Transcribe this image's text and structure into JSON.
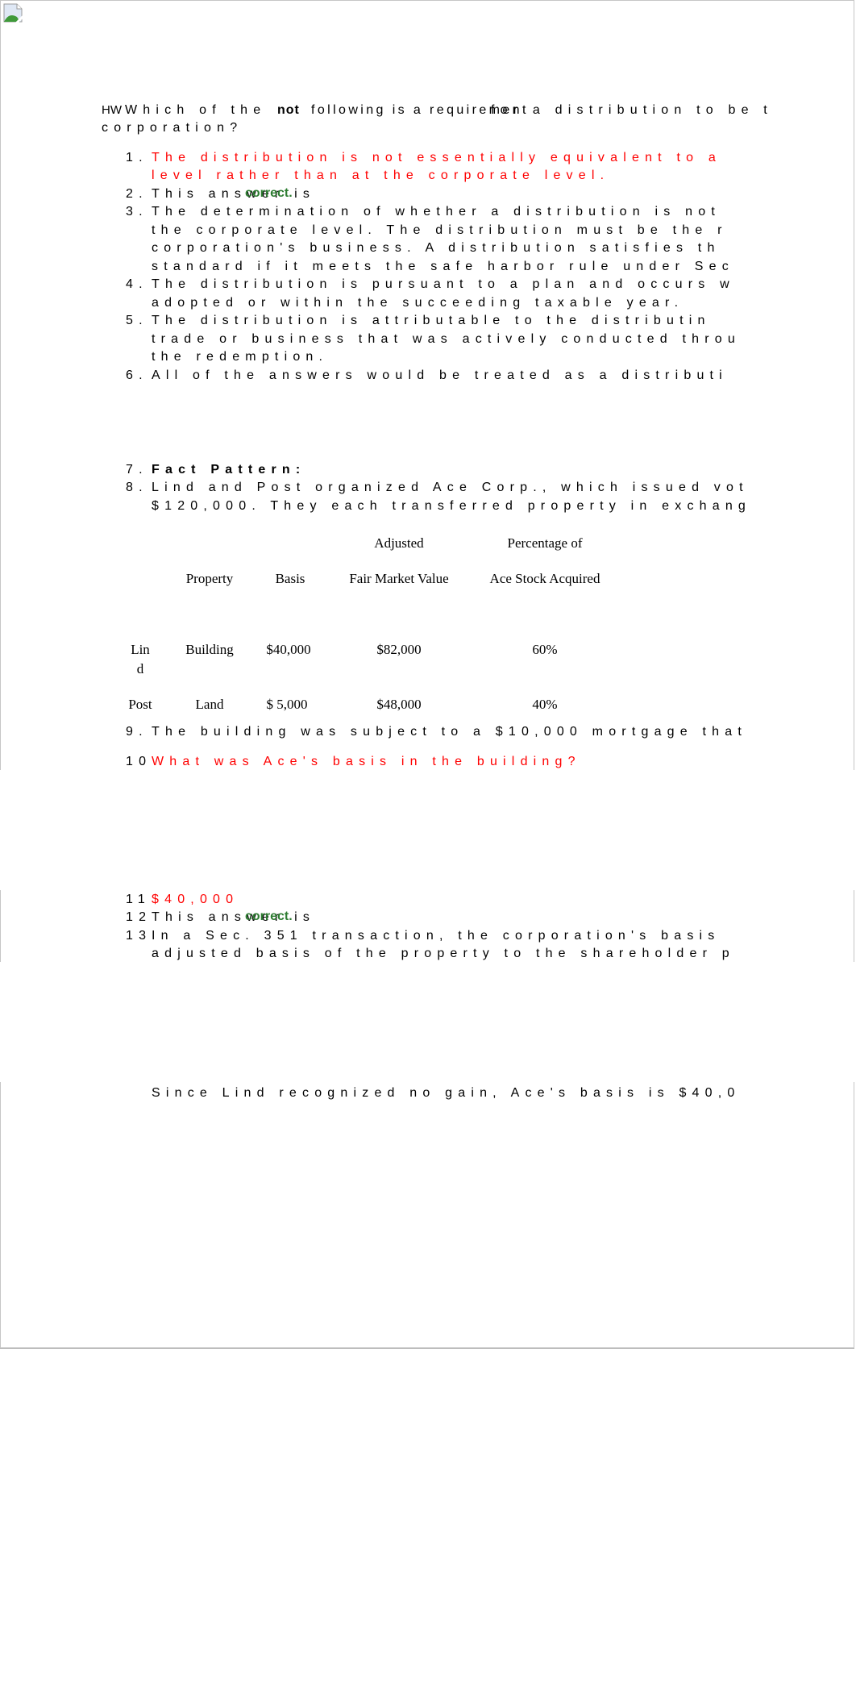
{
  "heading": {
    "prefix": "HW",
    "line1_a": "Which of the",
    "line1_bold": "not",
    "line1_overlap": "following is a requirement",
    "line1_b": "for a distribution to be t",
    "line2": "corporation?"
  },
  "q1_items": [
    {
      "num": "1.",
      "lines": [
        "The distribution is not essentially equivalent to a",
        "level rather than at the corporate level."
      ],
      "color": "red"
    },
    {
      "num": "2.",
      "lines": [
        "This answer is"
      ],
      "badge": "correct."
    },
    {
      "num": "3.",
      "lines": [
        "The determination of whether a distribution is not",
        "the corporate level. The distribution must be the r",
        "corporation's business. A distribution satisfies th",
        "standard if it meets the safe harbor rule under Sec"
      ]
    },
    {
      "num": "4.",
      "lines": [
        "The distribution is pursuant to a plan and occurs w",
        "adopted or within the succeeding taxable year."
      ]
    },
    {
      "num": "5.",
      "lines": [
        "The distribution is attributable to the distributin",
        "trade or business that was actively conducted throu",
        "the redemption."
      ]
    },
    {
      "num": "6.",
      "lines": [
        "All of the answers would be treated as a distributi"
      ]
    }
  ],
  "q2": {
    "item7": {
      "num": "7.",
      "text": "Fact Pattern:"
    },
    "item8": {
      "num": "8.",
      "lines": [
        "Lind and Post organized Ace Corp., which issued vot",
        "$120,000. They each transferred property in exchang"
      ]
    },
    "table": {
      "header_row1": {
        "adjusted": "Adjusted",
        "percentage": "Percentage of"
      },
      "header_row2": {
        "property": "Property",
        "basis": "Basis",
        "fmv": "Fair Market Value",
        "stock": "Ace Stock Acquired"
      },
      "rows": [
        {
          "name_a": "Lin",
          "name_b": "d",
          "property": "Building",
          "basis": "$40,000",
          "fmv": "$82,000",
          "pct": "60%"
        },
        {
          "name_a": "Post",
          "name_b": "",
          "property": "Land",
          "basis": "$ 5,000",
          "fmv": "$48,000",
          "pct": "40%"
        }
      ]
    },
    "item9": {
      "num": "9.",
      "text": "The building was subject to a $10,000 mortgage that"
    },
    "item10": {
      "num": "10",
      "text": "What was Ace's basis in the building?"
    },
    "item11": {
      "num": "11",
      "text": "$40,000"
    },
    "item12": {
      "num": "12",
      "text": "This answer is",
      "badge": "correct."
    },
    "item13": {
      "num": "13",
      "lines": [
        "In a Sec. 351 transaction, the corporation's basis",
        "adjusted basis of the property to the shareholder p"
      ]
    },
    "explanation": "Since Lind recognized no gain, Ace's basis is $40,0"
  },
  "colors": {
    "answer_red": "#ff0000",
    "correct_green": "#2e7d32",
    "frame_border": "#c6c6c6"
  }
}
